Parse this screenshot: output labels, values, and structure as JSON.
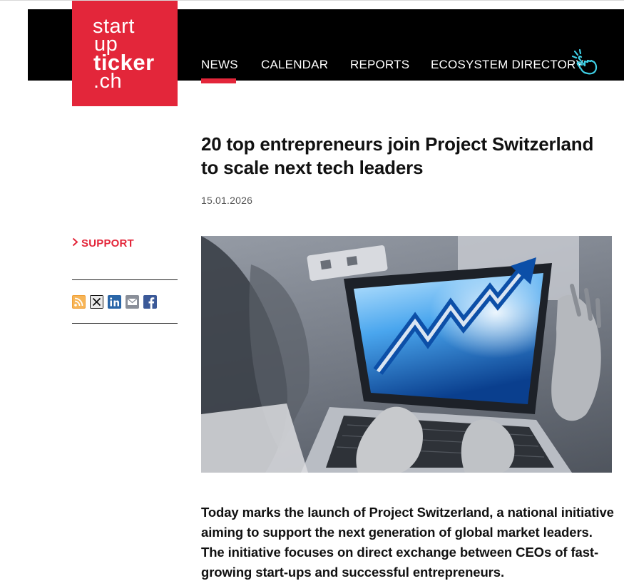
{
  "logo": {
    "line1": "start",
    "line2": "up",
    "line3": "ticker",
    "line4": ".ch"
  },
  "nav": {
    "items": [
      {
        "label": "NEWS",
        "active": true
      },
      {
        "label": "CALENDAR",
        "active": false
      },
      {
        "label": "REPORTS",
        "active": false
      },
      {
        "label": "ECOSYSTEM DIRECTORY",
        "active": false
      }
    ],
    "hand_icon": "pointing-hand-icon"
  },
  "article": {
    "title": "20 top entrepreneurs join Project Switzerland to scale next tech leaders",
    "date": "15.01.2026",
    "lead": "Today marks the launch of Project Switzerland, a national initiative aiming to support the next generation of global market leaders. The initiative focuses on direct exchange between CEOs of fast-growing start-ups and successful entrepreneurs."
  },
  "sidebar": {
    "support_label": "SUPPORT",
    "share_icons": [
      "rss-icon",
      "x-icon",
      "linkedin-icon",
      "email-icon",
      "facebook-icon"
    ]
  },
  "colors": {
    "brand_red": "#e3263a",
    "header_black": "#000000",
    "hand_cyan": "#3fd0e6"
  }
}
